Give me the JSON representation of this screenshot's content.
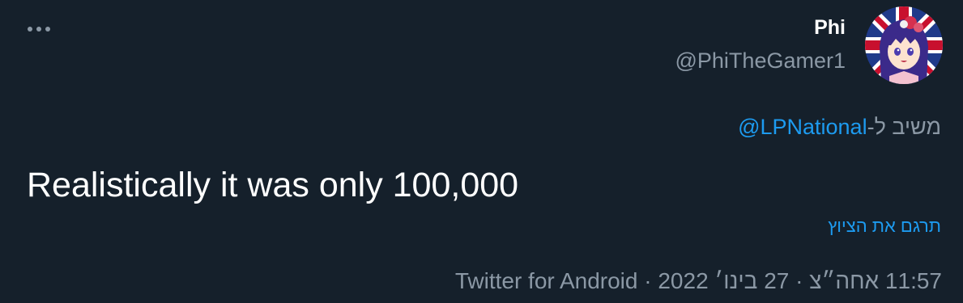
{
  "author": {
    "display_name": "Phi",
    "handle": "@PhiTheGamer1",
    "avatar_icon": "anime-avatar-icon"
  },
  "more_icon": "more-horizontal-icon",
  "reply": {
    "prefix": "משיב ל-",
    "mention": "@LPNational"
  },
  "tweet": {
    "text": "Realistically it was only 100,000"
  },
  "translate": {
    "label": "תרגם את הציוץ"
  },
  "meta": {
    "time": "11:57 אחה״צ",
    "date": "27 בינו׳ 2022",
    "separator": " · ",
    "source": "Twitter for Android"
  },
  "colors": {
    "background": "#15202b",
    "text_primary": "#ffffff",
    "text_secondary": "#8b98a5",
    "accent": "#1d9bf0"
  }
}
